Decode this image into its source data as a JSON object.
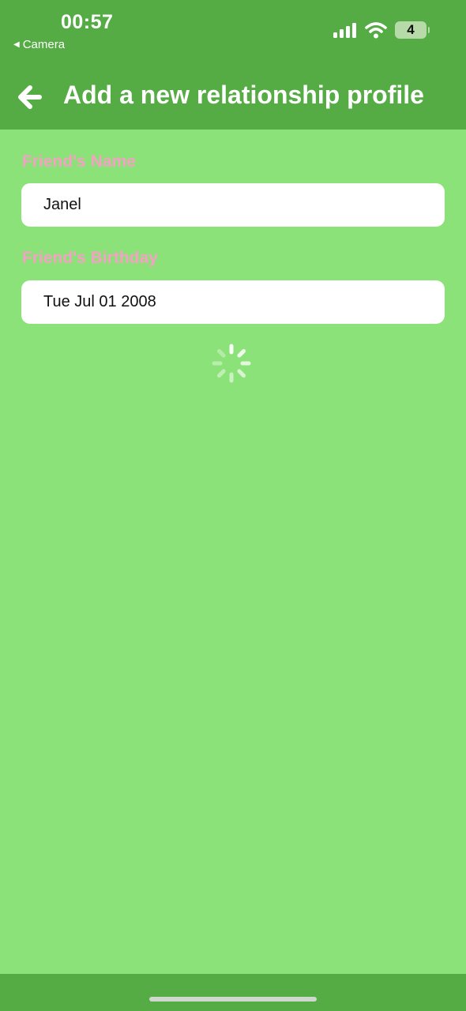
{
  "status_bar": {
    "time": "00:57",
    "back_app": "Camera",
    "battery_level": "4"
  },
  "header": {
    "title": "Add a new relationship profile"
  },
  "form": {
    "name_label": "Friend's Name",
    "name_value": "Janel",
    "birthday_label": "Friend's Birthday",
    "birthday_value": "Tue Jul 01 2008"
  },
  "colors": {
    "header_bg": "#55ac45",
    "page_bg": "#8be278",
    "label_pink": "#f4a2c3"
  }
}
